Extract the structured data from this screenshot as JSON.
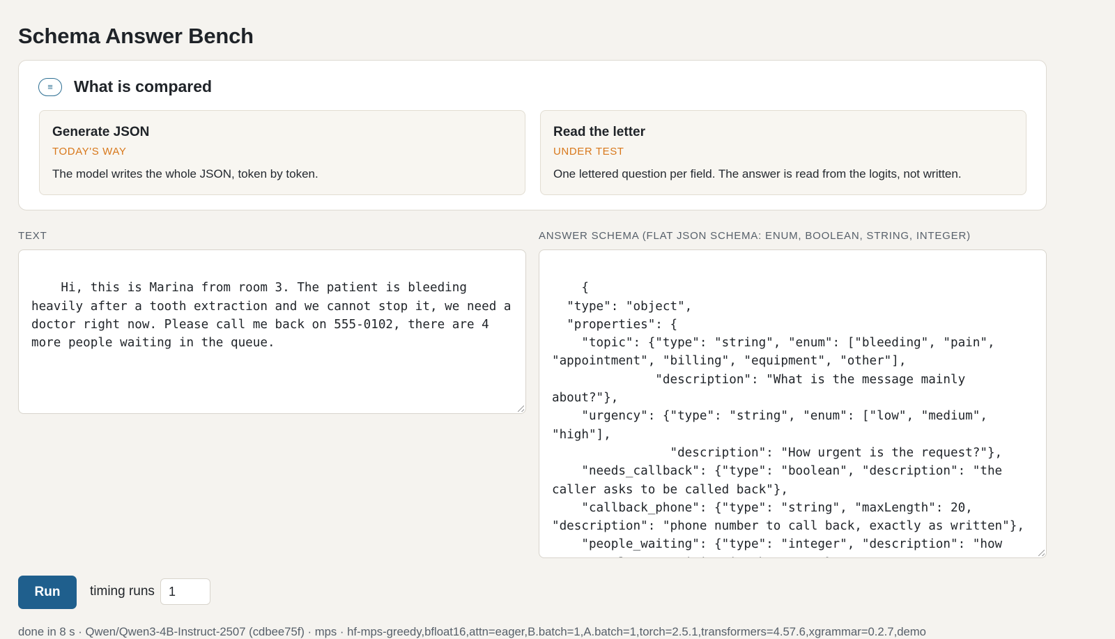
{
  "page": {
    "title": "Schema Answer Bench"
  },
  "compare": {
    "icon": "menu-lines-icon",
    "icon_glyph": "≡",
    "title": "What is compared",
    "methods": [
      {
        "name": "Generate JSON",
        "tag": "TODAY'S WAY",
        "description": "The model writes the whole JSON, token by token."
      },
      {
        "name": "Read the letter",
        "tag": "UNDER TEST",
        "description": "One lettered question per field. The answer is read from the logits, not written."
      }
    ]
  },
  "inputs": {
    "text_label": "TEXT",
    "text_value": "Hi, this is Marina from room 3. The patient is bleeding heavily after a tooth extraction and we cannot stop it, we need a doctor right now. Please call me back on 555-0102, there are 4 more people waiting in the queue.",
    "schema_label": "ANSWER SCHEMA (FLAT JSON SCHEMA: ENUM, BOOLEAN, STRING, INTEGER)",
    "schema_value": "{\n  \"type\": \"object\",\n  \"properties\": {\n    \"topic\": {\"type\": \"string\", \"enum\": [\"bleeding\", \"pain\", \"appointment\", \"billing\", \"equipment\", \"other\"],\n              \"description\": \"What is the message mainly about?\"},\n    \"urgency\": {\"type\": \"string\", \"enum\": [\"low\", \"medium\", \"high\"],\n                \"description\": \"How urgent is the request?\"},\n    \"needs_callback\": {\"type\": \"boolean\", \"description\": \"the caller asks to be called back\"},\n    \"callback_phone\": {\"type\": \"string\", \"maxLength\": 20, \"description\": \"phone number to call back, exactly as written\"},\n    \"people_waiting\": {\"type\": \"integer\", \"description\": \"how many people are waiting in the queue\"}\n  }\n}"
  },
  "controls": {
    "run_label": "Run",
    "timing_label": "timing runs",
    "timing_value": "1"
  },
  "status": {
    "text": "done in 8 s · Qwen/Qwen3-4B-Instruct-2507 (cdbee75f) · mps · hf-mps-greedy,bfloat16,attn=eager,B.batch=1,A.batch=1,torch=2.5.1,transformers=4.57.6,xgrammar=0.2.7,demo"
  }
}
